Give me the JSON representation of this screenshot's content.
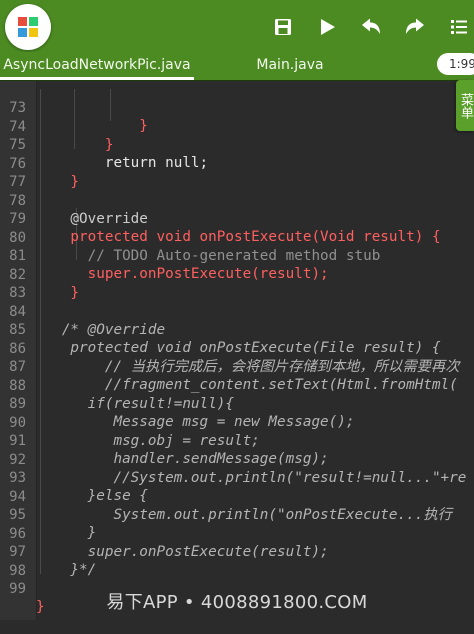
{
  "toolbar": {
    "logo_icon": "app-logo-icon",
    "buttons": [
      {
        "name": "save-button",
        "icon": "floppy-disk-icon"
      },
      {
        "name": "run-button",
        "icon": "play-icon"
      },
      {
        "name": "undo-button",
        "icon": "undo-arrow-icon"
      },
      {
        "name": "redo-button",
        "icon": "redo-arrow-icon"
      },
      {
        "name": "menu-button",
        "icon": "list-menu-icon"
      }
    ]
  },
  "tabs": [
    {
      "label": "AsyncLoadNetworkPic.java",
      "active": true
    },
    {
      "label": "Main.java",
      "active": false
    }
  ],
  "time_display": "1:99",
  "side_tab_label": "菜单",
  "editor": {
    "lines": [
      {
        "num": "73",
        "text": "            }"
      },
      {
        "num": "74",
        "text": "        }"
      },
      {
        "num": "75",
        "text": "        return null;"
      },
      {
        "num": "76",
        "text": "    }"
      },
      {
        "num": "77",
        "text": ""
      },
      {
        "num": "78",
        "text": "    @Override"
      },
      {
        "num": "79",
        "text": "    protected void onPostExecute(Void result) {"
      },
      {
        "num": "80",
        "text": "      // TODO Auto-generated method stub"
      },
      {
        "num": "81",
        "text": "      super.onPostExecute(result);"
      },
      {
        "num": "82",
        "text": "    }"
      },
      {
        "num": "83",
        "text": ""
      },
      {
        "num": "84",
        "text": "   /* @Override"
      },
      {
        "num": "85",
        "text": "    protected void onPostExecute(File result) {"
      },
      {
        "num": "86",
        "text": "        // 当执行完成后，会将图片存储到本地，所以需要再次"
      },
      {
        "num": "87",
        "text": "        //fragment_content.setText(Html.fromHtml("
      },
      {
        "num": "88",
        "text": "      if(result!=null){"
      },
      {
        "num": "89",
        "text": "         Message msg = new Message();"
      },
      {
        "num": "90",
        "text": "         msg.obj = result;"
      },
      {
        "num": "91",
        "text": "         handler.sendMessage(msg);"
      },
      {
        "num": "92",
        "text": "         //System.out.println(\"result!=null...\"+re"
      },
      {
        "num": "93",
        "text": "      }else {"
      },
      {
        "num": "94",
        "text": "         System.out.println(\"onPostExecute...执行"
      },
      {
        "num": "95",
        "text": "      }"
      },
      {
        "num": "96",
        "text": "      super.onPostExecute(result);"
      },
      {
        "num": "97",
        "text": "    }*/"
      },
      {
        "num": "98",
        "text": ""
      },
      {
        "num": "99",
        "text": "}"
      }
    ]
  },
  "watermark": "易下APP • 4008891800.COM"
}
